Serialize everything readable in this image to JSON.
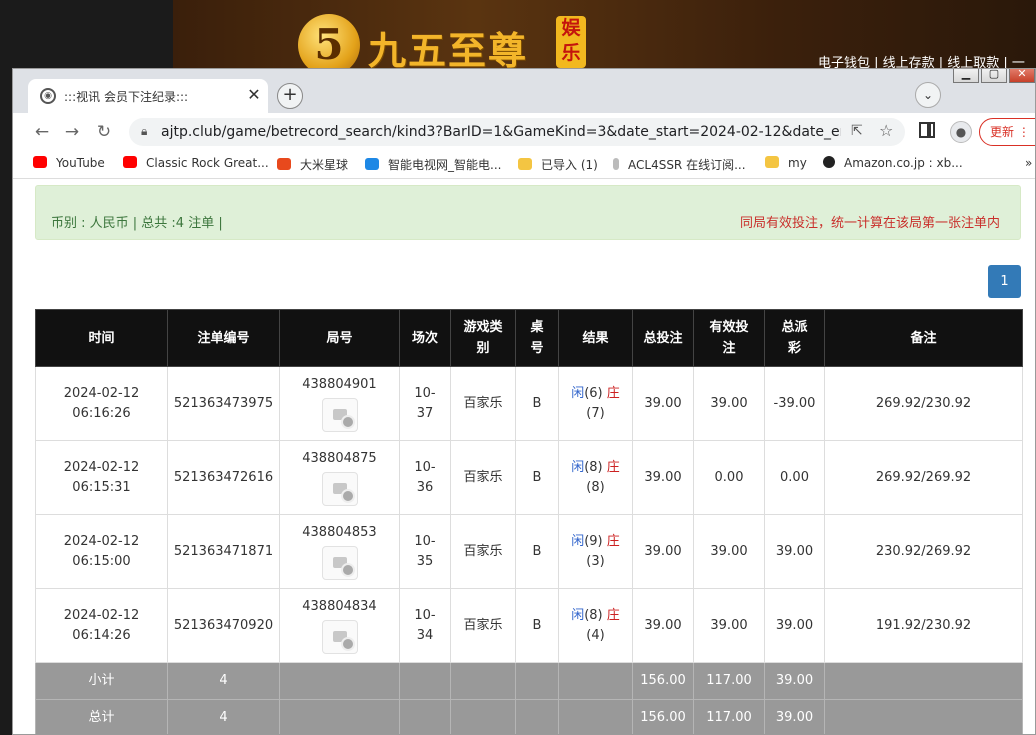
{
  "background_site": {
    "logo_number": "5",
    "logo_text": "九五至尊",
    "logo_badge": "娱乐",
    "nav": "电子钱包 | 线上存款 | 线上取款 | 一"
  },
  "browser": {
    "tab_title": ":::视讯 会员下注纪录:::",
    "url": "ajtp.club/game/betrecord_search/kind3?BarID=1&GameKind=3&date_start=2024-02-12&date_en...",
    "update_label": "更新",
    "bookmarks": [
      {
        "label": "YouTube",
        "icon": "youtube-icon",
        "color": "#ff0000"
      },
      {
        "label": "Classic Rock Great...",
        "icon": "youtube-icon",
        "color": "#ff0000"
      },
      {
        "label": "大米星球",
        "icon": "star-app-icon",
        "color": "#e8491d"
      },
      {
        "label": "智能电视网_智能电...",
        "icon": "tv-site-icon",
        "color": "#1e88e5"
      },
      {
        "label": "已导入 (1)",
        "icon": "folder-icon",
        "color": "#f4c542"
      },
      {
        "label": "ACL4SSR 在线订阅...",
        "icon": "page-icon",
        "color": "#bbbbbb"
      },
      {
        "label": "my",
        "icon": "folder-icon",
        "color": "#f4c542"
      },
      {
        "label": "Amazon.co.jp : xb...",
        "icon": "amazon-icon",
        "color": "#222222"
      }
    ],
    "more_bookmarks": "»"
  },
  "summary": {
    "left": "币别 : 人民币 | 总共 :4 注单 |",
    "right": "同局有效投注，统一计算在该局第一张注单内"
  },
  "pager": {
    "current": "1"
  },
  "table": {
    "headers": [
      "时间",
      "注单编号",
      "局号",
      "场次",
      "游戏类别",
      "桌号",
      "结果",
      "总投注",
      "有效投注",
      "总派彩",
      "备注"
    ],
    "rows": [
      {
        "date": "2024-02-12",
        "time": "06:16:26",
        "bet_id": "521363473975",
        "round_no": "438804901",
        "session_a": "10-",
        "session_b": "37",
        "game": "百家乐",
        "table": "B",
        "player_label": "闲",
        "player_score": "(6)",
        "banker_label": "庄",
        "banker_score": "(7)",
        "total_bet": "39.00",
        "valid_bet": "39.00",
        "payout": "-39.00",
        "note": "269.92/230.92"
      },
      {
        "date": "2024-02-12",
        "time": "06:15:31",
        "bet_id": "521363472616",
        "round_no": "438804875",
        "session_a": "10-",
        "session_b": "36",
        "game": "百家乐",
        "table": "B",
        "player_label": "闲",
        "player_score": "(8)",
        "banker_label": "庄",
        "banker_score": "(8)",
        "total_bet": "39.00",
        "valid_bet": "0.00",
        "payout": "0.00",
        "note": "269.92/269.92"
      },
      {
        "date": "2024-02-12",
        "time": "06:15:00",
        "bet_id": "521363471871",
        "round_no": "438804853",
        "session_a": "10-",
        "session_b": "35",
        "game": "百家乐",
        "table": "B",
        "player_label": "闲",
        "player_score": "(9)",
        "banker_label": "庄",
        "banker_score": "(3)",
        "total_bet": "39.00",
        "valid_bet": "39.00",
        "payout": "39.00",
        "note": "230.92/269.92"
      },
      {
        "date": "2024-02-12",
        "time": "06:14:26",
        "bet_id": "521363470920",
        "round_no": "438804834",
        "session_a": "10-",
        "session_b": "34",
        "game": "百家乐",
        "table": "B",
        "player_label": "闲",
        "player_score": "(8)",
        "banker_label": "庄",
        "banker_score": "(4)",
        "total_bet": "39.00",
        "valid_bet": "39.00",
        "payout": "39.00",
        "note": "191.92/230.92"
      }
    ],
    "subtotal": {
      "label": "小计",
      "count": "4",
      "total_bet": "156.00",
      "valid_bet": "117.00",
      "payout": "39.00"
    },
    "grand_total": {
      "label": "总计",
      "count": "4",
      "total_bet": "156.00",
      "valid_bet": "117.00",
      "payout": "39.00"
    }
  },
  "colors": {
    "accent": "#337ab7",
    "negative": "#d9231e",
    "positive_bet": "#2a6ac9",
    "alert_bg": "#dff0d8"
  }
}
